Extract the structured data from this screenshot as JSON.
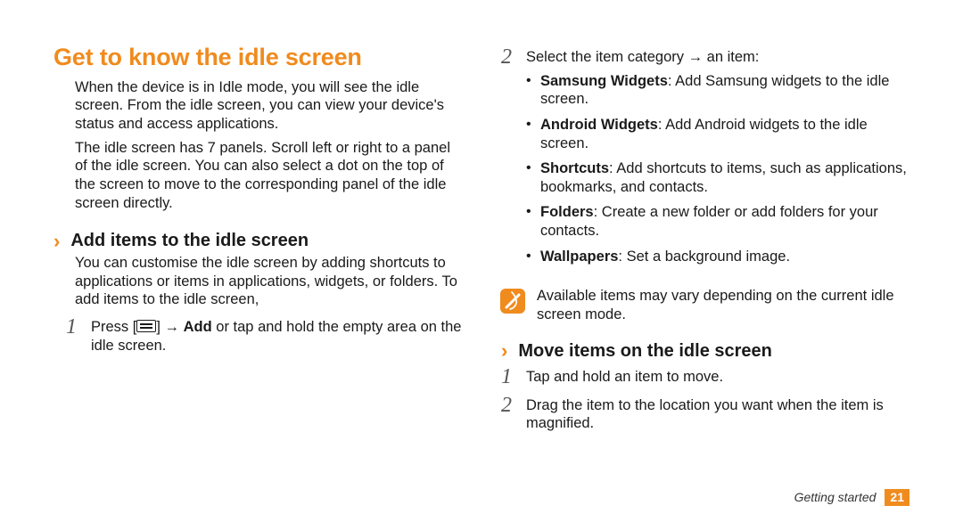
{
  "left": {
    "section_title": "Get to know the idle screen",
    "intro1": "When the device is in Idle mode, you will see the idle screen. From the idle screen, you can view your device's status and access applications.",
    "intro2": "The idle screen has 7 panels. Scroll left or right to a panel of the idle screen. You can also select a dot on the top of the screen to move to the corresponding panel of the idle screen directly.",
    "sub_add": "Add items to the idle screen",
    "add_intro": "You can customise the idle screen by adding shortcuts to applications or items in applications, widgets, or folders. To add items to the idle screen,",
    "step1": {
      "num": "1",
      "prefix": "Press [",
      "mid": "] → ",
      "bold": "Add",
      "suffix": " or tap and hold the empty area on the idle screen."
    }
  },
  "right": {
    "step2": {
      "num": "2",
      "lead": "Select the item category → an item:",
      "items": [
        {
          "term": "Samsung Widgets",
          "text": ": Add Samsung widgets to the idle screen."
        },
        {
          "term": "Android Widgets",
          "text": ": Add Android widgets to the idle screen."
        },
        {
          "term": "Shortcuts",
          "text": ": Add shortcuts to items, such as applications, bookmarks, and contacts."
        },
        {
          "term": "Folders",
          "text": ": Create a new folder or add folders for your contacts."
        },
        {
          "term": "Wallpapers",
          "text": ": Set a background image."
        }
      ]
    },
    "note": "Available items may vary depending on the current idle screen mode.",
    "sub_move": "Move items on the idle screen",
    "move_steps": [
      {
        "num": "1",
        "text": "Tap and hold an item to move."
      },
      {
        "num": "2",
        "text": "Drag the item to the location you want when the item is magnified."
      }
    ]
  },
  "footer": {
    "chapter": "Getting started",
    "page": "21"
  }
}
